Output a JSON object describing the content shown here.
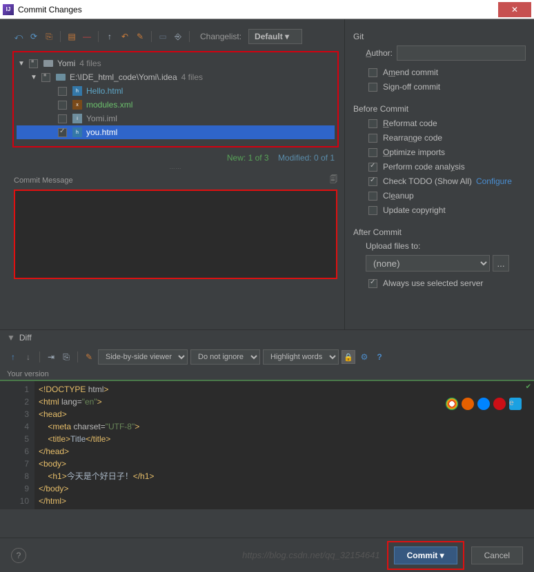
{
  "title": "Commit Changes",
  "toolbar": {
    "changelist_label": "Changelist:",
    "changelist_value": "Default"
  },
  "tree": {
    "root": {
      "name": "Yomi",
      "count": "4 files"
    },
    "folder": {
      "path": "E:\\IDE_html_code\\Yomi\\.idea",
      "count": "4 files"
    },
    "files": [
      {
        "name": "Hello.html",
        "color": "blue"
      },
      {
        "name": "modules.xml",
        "color": "green"
      },
      {
        "name": "Yomi.iml",
        "color": "gray"
      },
      {
        "name": "you.html",
        "color": "blue",
        "checked": true,
        "selected": true
      }
    ]
  },
  "status": {
    "new": "New: 1 of 3",
    "modified": "Modified: 0 of 1"
  },
  "commit_message_label": "Commit Message",
  "right": {
    "git_title": "Git",
    "author_label": "Author:",
    "amend": "Amend commit",
    "signoff": "Sign-off commit",
    "before_title": "Before Commit",
    "reformat": "Reformat code",
    "rearrange": "Rearrange code",
    "optimize": "Optimize imports",
    "analysis": "Perform code analysis",
    "todo": "Check TODO (Show All)",
    "configure": "Configure",
    "cleanup": "Cleanup",
    "copyright": "Update copyright",
    "after_title": "After Commit",
    "upload_label": "Upload files to:",
    "upload_value": "(none)",
    "always_server": "Always use selected server"
  },
  "diff": {
    "header": "Diff",
    "viewmode": "Side-by-side viewer",
    "ignore": "Do not ignore",
    "highlight": "Highlight words",
    "version_label": "Your version"
  },
  "code": {
    "lines": [
      "1",
      "2",
      "3",
      "4",
      "5",
      "6",
      "7",
      "8",
      "9",
      "10"
    ],
    "l1_a": "<!DOCTYPE ",
    "l1_b": "html",
    "l1_c": ">",
    "l2_a": "<html ",
    "l2_b": "lang=",
    "l2_c": "\"en\"",
    "l2_d": ">",
    "l3": "<head>",
    "l4_a": "    <meta ",
    "l4_b": "charset=",
    "l4_c": "\"UTF-8\"",
    "l4_d": ">",
    "l5_a": "    <title>",
    "l5_b": "Title",
    "l5_c": "</title>",
    "l6": "</head>",
    "l7": "<body>",
    "l8_a": "    <h1>",
    "l8_b": "今天是个好日子！",
    "l8_c": "</h1>",
    "l9": "</body>",
    "l10": "</html>"
  },
  "footer": {
    "commit": "Commit",
    "cancel": "Cancel",
    "watermark": "https://blog.csdn.net/qq_32154641"
  }
}
